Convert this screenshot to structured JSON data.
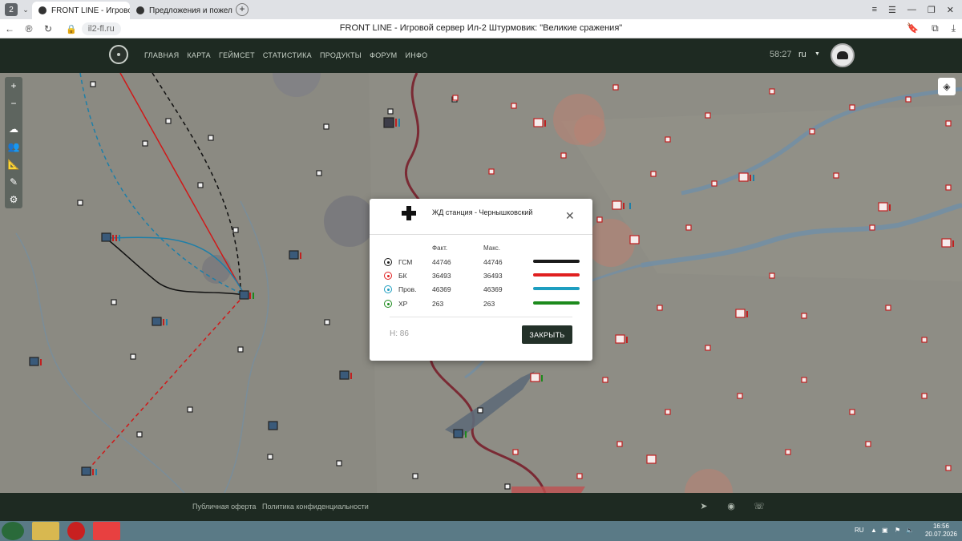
{
  "browser": {
    "tab_count": "2",
    "tabs": [
      {
        "label": "FRONT LINE - Игровой"
      },
      {
        "label": "Предложения и пожелан"
      }
    ],
    "new_tab": "+",
    "url": "il2-fl.ru",
    "page_title": "FRONT LINE - Игровой сервер Ил-2 Штурмовик: \"Великие сражения\"",
    "extension_badge": "2"
  },
  "site": {
    "menu": [
      "ГЛАВНАЯ",
      "КАРТА",
      "ГЕЙМСЕТ",
      "СТАТИСТИКА",
      "ПРОДУКТЫ",
      "ФОРУМ",
      "ИНФО"
    ],
    "timer": "58:27",
    "language": "ru"
  },
  "map_tools": {
    "zoom_in": "+",
    "zoom_out": "−"
  },
  "modal": {
    "title": "ЖД станция - Чернышковский",
    "col_fact": "Факт.",
    "col_max": "Макс.",
    "rows": [
      {
        "name": "ГСМ",
        "fact": "44746",
        "max": "44746",
        "color": "#1a1a1a"
      },
      {
        "name": "БК",
        "fact": "36493",
        "max": "36493",
        "color": "#e02020"
      },
      {
        "name": "Пров.",
        "fact": "46369",
        "max": "46369",
        "color": "#1e9ec0"
      },
      {
        "name": "ХР",
        "fact": "263",
        "max": "263",
        "color": "#1c8a1c"
      }
    ],
    "h_label": "Н: 86",
    "close_label": "ЗАКРЫТЬ"
  },
  "footer": {
    "offer_link": "Публичная оферта",
    "privacy_link": "Политика конфиденциальности"
  },
  "taskbar": {
    "lang": "RU",
    "time": "16:56",
    "date": "20.07.2026"
  }
}
